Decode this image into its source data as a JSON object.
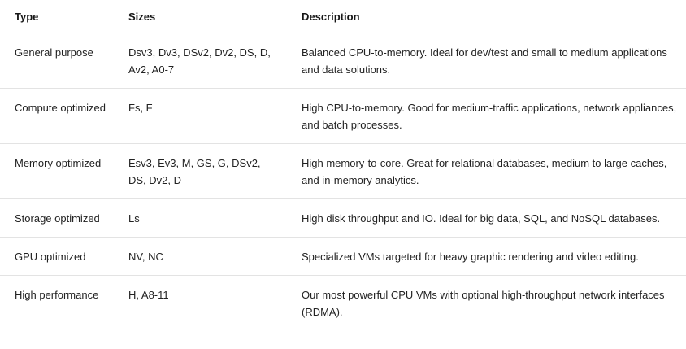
{
  "table": {
    "headers": [
      "Type",
      "Sizes",
      "Description"
    ],
    "rows": [
      {
        "type": "General purpose",
        "sizes": "Dsv3, Dv3, DSv2, Dv2, DS, D, Av2, A0-7",
        "description": "Balanced CPU-to-memory. Ideal for dev/test and small to medium applications and data solutions."
      },
      {
        "type": "Compute optimized",
        "sizes": "Fs, F",
        "description": "High CPU-to-memory. Good for medium-traffic applications, network appliances, and batch processes."
      },
      {
        "type": "Memory optimized",
        "sizes": "Esv3, Ev3, M, GS, G, DSv2, DS, Dv2, D",
        "description": "High memory-to-core. Great for relational databases, medium to large caches, and in-memory analytics."
      },
      {
        "type": "Storage optimized",
        "sizes": "Ls",
        "description": "High disk throughput and IO. Ideal for big data, SQL, and NoSQL databases."
      },
      {
        "type": "GPU optimized",
        "sizes": "NV, NC",
        "description": "Specialized VMs targeted for heavy graphic rendering and video editing."
      },
      {
        "type": "High performance",
        "sizes": "H, A8-11",
        "description": "Our most powerful CPU VMs with optional high-throughput network interfaces (RDMA)."
      }
    ]
  }
}
